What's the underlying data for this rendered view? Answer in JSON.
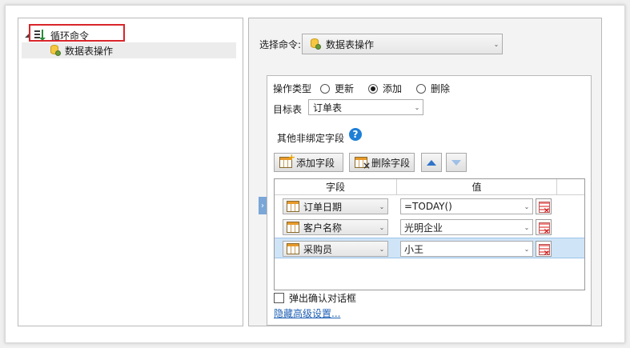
{
  "tree": {
    "root": {
      "label": "循环命令",
      "expander": "◢"
    },
    "child": {
      "label": "数据表操作"
    }
  },
  "command": {
    "label": "选择命令:",
    "selected": "数据表操作"
  },
  "operation": {
    "label": "操作类型",
    "options": [
      {
        "label": "更新",
        "selected": false
      },
      {
        "label": "添加",
        "selected": true
      },
      {
        "label": "删除",
        "selected": false
      }
    ]
  },
  "target": {
    "label": "目标表",
    "selected": "订单表"
  },
  "other_fields": {
    "label": "其他非绑定字段",
    "help_glyph": "?"
  },
  "toolbar": {
    "add_label": "添加字段",
    "delete_label": "删除字段"
  },
  "grid": {
    "headers": [
      "字段",
      "值"
    ],
    "rows": [
      {
        "field": "订单日期",
        "value": "=TODAY()",
        "selected": false
      },
      {
        "field": "客户名称",
        "value": "光明企业",
        "selected": false
      },
      {
        "field": "采购员",
        "value": "小王",
        "selected": true
      }
    ]
  },
  "confirm_dialog": {
    "label": "弹出确认对话框",
    "checked": false
  },
  "advanced_link": "隐藏高级设置...",
  "colors": {
    "highlight_border": "#d9252a",
    "link": "#1e5fb4",
    "selected_row": "#cfe4f7",
    "help_icon": "#1e7fd6"
  }
}
